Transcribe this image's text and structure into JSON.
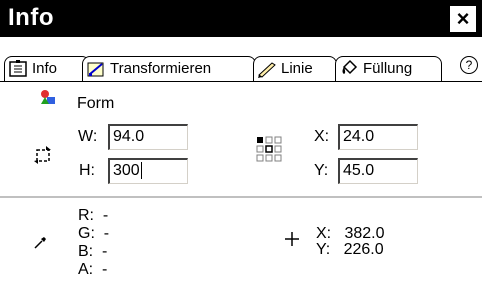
{
  "window": {
    "title": "Info",
    "close_glyph": "×"
  },
  "tabs": [
    {
      "label": "Info",
      "icon": "info-panel-icon"
    },
    {
      "label": "Transformieren",
      "icon": "transform-icon"
    },
    {
      "label": "Linie",
      "icon": "line-icon"
    },
    {
      "label": "Füllung",
      "icon": "fill-icon"
    }
  ],
  "help_glyph": "?",
  "shape": {
    "label": "Form",
    "icon": "shape-icon"
  },
  "size": {
    "w_label": "W:",
    "w_value": "94.0",
    "h_label": "H:",
    "h_value": "300"
  },
  "position": {
    "x_label": "X:",
    "x_value": "24.0",
    "y_label": "Y:",
    "y_value": "45.0"
  },
  "color_readout": {
    "r_label": "R:",
    "r_value": "-",
    "g_label": "G:",
    "g_value": "-",
    "b_label": "B:",
    "b_value": "-",
    "a_label": "A:",
    "a_value": "-"
  },
  "cursor": {
    "x_label": "X:",
    "x_value": "382.0",
    "y_label": "Y:",
    "y_value": "226.0"
  }
}
